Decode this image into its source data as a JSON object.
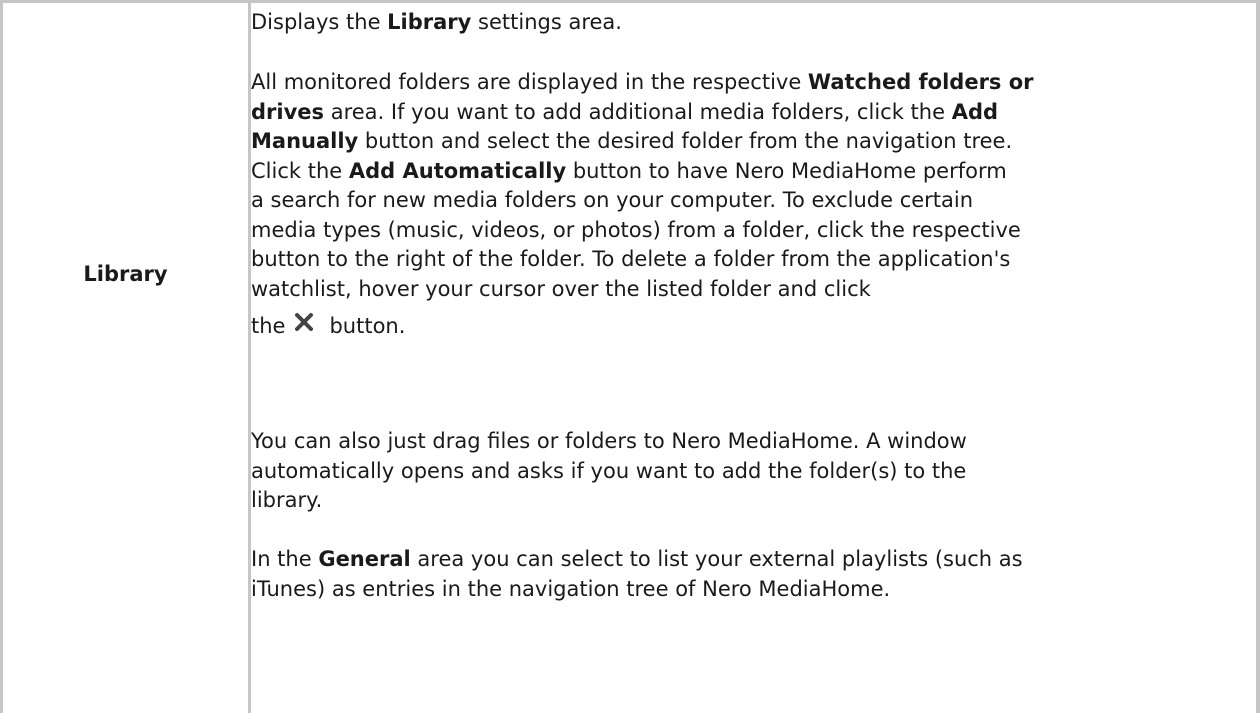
{
  "row": {
    "label": "Library",
    "p1": {
      "t1": "Displays the ",
      "b1": "Library",
      "t2": " settings area."
    },
    "p2": {
      "l1a": "All monitored folders are displayed in the respective ",
      "l1b": "Watched folders or",
      "l2a": "drives",
      "l2b": " area. If you want to add additional media folders, click the ",
      "l2c": "Add",
      "l3a": "Manually",
      "l3b": " button and select the desired folder from the navigation tree.",
      "l4a": "Click the ",
      "l4b": "Add Automatically",
      "l4c": " button to have Nero MediaHome perform",
      "l5": "a search for new media folders on your computer. To exclude certain",
      "l6": "media types (music, videos, or photos) from a folder, click the respective",
      "l7": "button to the right of the folder. To delete a folder from the application's",
      "l8": "watchlist, hover your cursor over the listed folder and click",
      "l9a": "the",
      "l9b": "button.",
      "icon": "close-x-icon"
    },
    "p3": {
      "l1": "You can also just drag files or folders to Nero MediaHome. A window",
      "l2": "automatically opens and asks if you want to add the folder(s) to the",
      "l3": "library."
    },
    "p4": {
      "l1a": "In the ",
      "l1b": "General",
      "l1c": " area you can select to list your external playlists (such as",
      "l2": "iTunes) as entries in the navigation tree of Nero MediaHome."
    }
  },
  "colors": {
    "border": "#c6c6c6",
    "text": "#1a1a1a",
    "icon": "#444444"
  }
}
